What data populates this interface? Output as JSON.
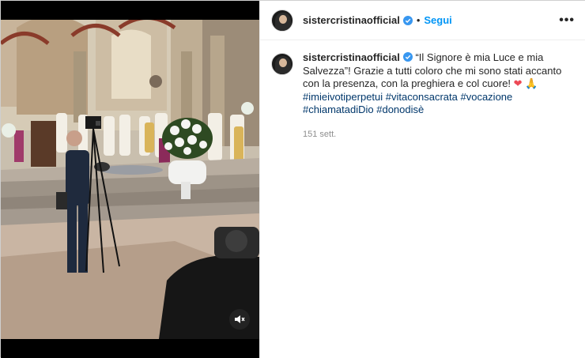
{
  "post": {
    "username": "sistercristinaofficial",
    "dot": "•",
    "follow_label": "Segui",
    "more_label": "•••",
    "caption": {
      "username": "sistercristinaofficial",
      "text_1": "“Il Signore è mia Luce e mia Salvezza”! Grazie a tutti coloro che mi sono stati accanto con la presenza, con la preghiera e col cuore!",
      "heart": "❤",
      "prayer": "🙏",
      "hashtags": [
        "#imieivotiperpetui",
        "#vitaconsacrata",
        "#vocazione",
        "#chiamatadiDio",
        "#donodisè"
      ]
    },
    "timestamp": "151 sett."
  },
  "colors": {
    "link": "#0095f6",
    "hashtag": "#00376b",
    "verified": "#3897f0",
    "muted": "#8e8e8e"
  },
  "icons": {
    "mute": "speaker-muted-icon",
    "verified": "verified-badge-icon",
    "more": "more-options-icon"
  }
}
